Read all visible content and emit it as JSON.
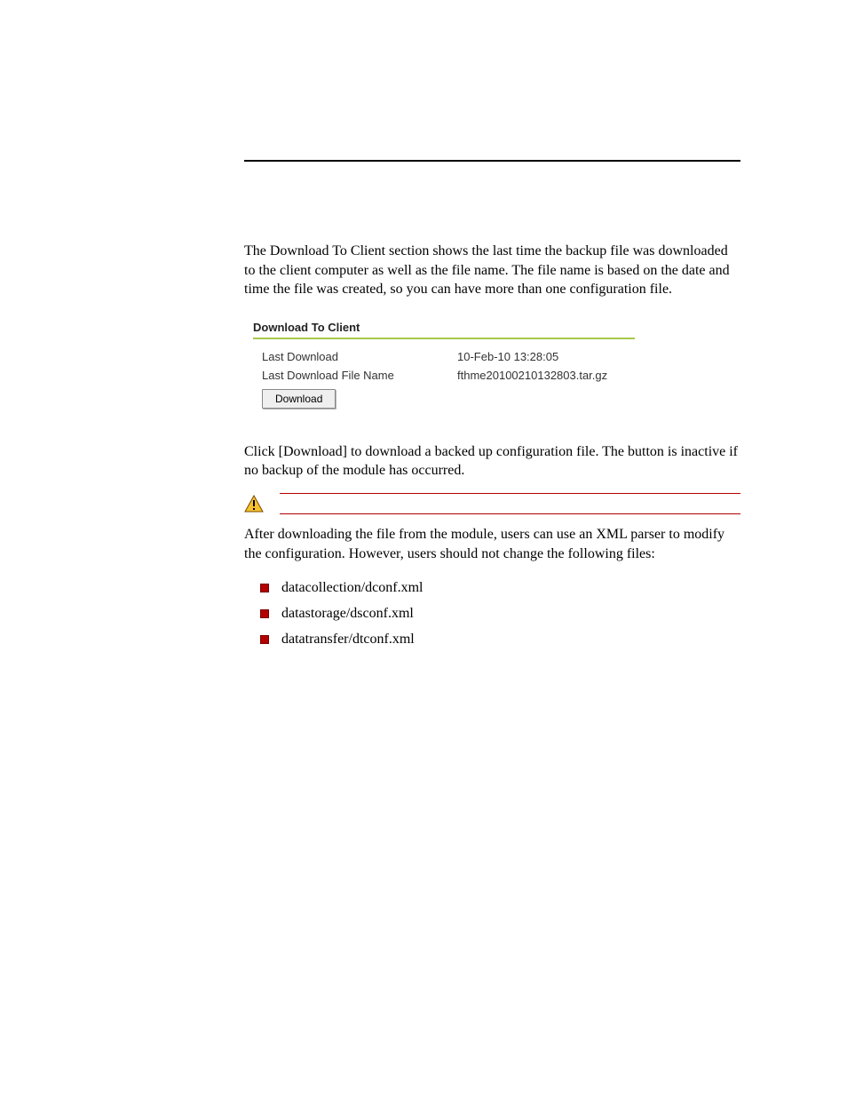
{
  "para1": "The Download To Client section shows the last time the backup file was downloaded to the client computer as well as the file name. The file name is based on the date and time the file was created, so you can have more than one configuration file.",
  "figure": {
    "heading": "Download To Client",
    "row1_label": "Last Download",
    "row1_value": "10-Feb-10 13:28:05",
    "row2_label": "Last Download File Name",
    "row2_value": "fthme20100210132803.tar.gz",
    "button": "Download"
  },
  "para2": "Click [Download] to download a backed up configuration file. The button is inactive if no backup of the module has occurred.",
  "para3": "After downloading the file from the module, users can use an XML parser to modify the configuration. However, users should not change the following files:",
  "files": {
    "f0": "datacollection/dconf.xml",
    "f1": "datastorage/dsconf.xml",
    "f2": "datatransfer/dtconf.xml"
  }
}
